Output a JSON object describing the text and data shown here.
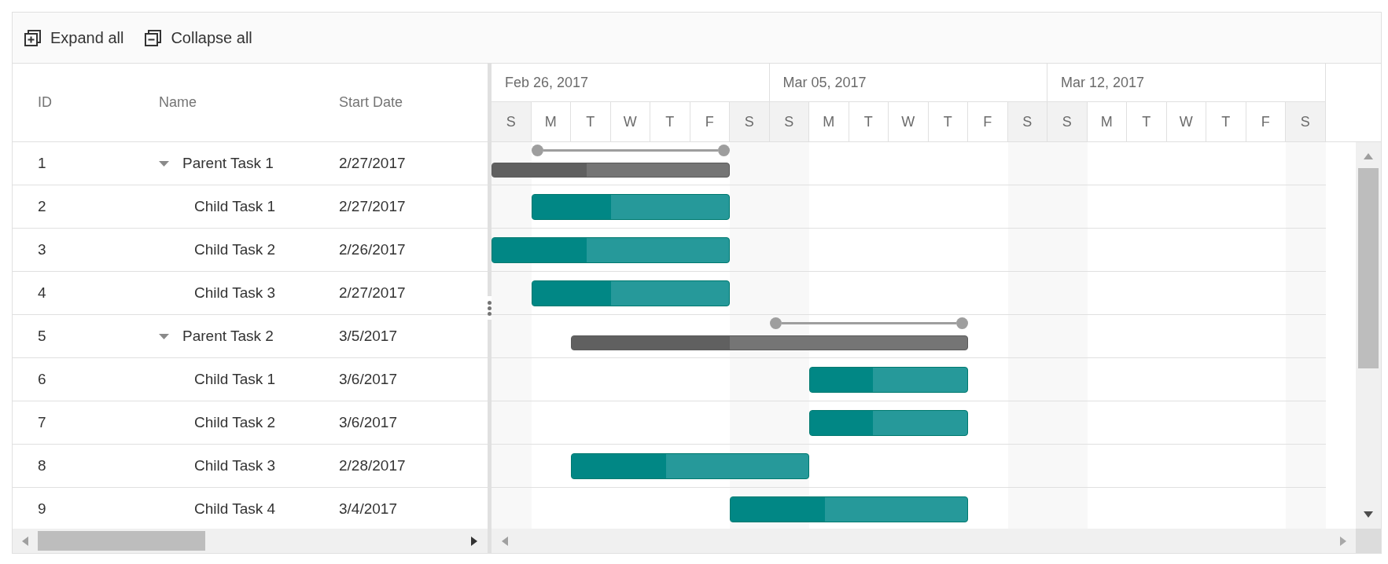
{
  "toolbar": [
    {
      "kind": "expand",
      "label": "Expand all"
    },
    {
      "kind": "collapse",
      "label": "Collapse all"
    }
  ],
  "grid": {
    "columns": [
      "ID",
      "Name",
      "Start Date"
    ]
  },
  "timeline": {
    "weeks": [
      "Feb 26, 2017",
      "Mar 05, 2017",
      "Mar 12, 2017"
    ],
    "days": [
      {
        "label": "S",
        "weekend": true
      },
      {
        "label": "M",
        "weekend": false
      },
      {
        "label": "T",
        "weekend": false
      },
      {
        "label": "W",
        "weekend": false
      },
      {
        "label": "T",
        "weekend": false
      },
      {
        "label": "F",
        "weekend": false
      },
      {
        "label": "S",
        "weekend": true
      },
      {
        "label": "S",
        "weekend": true
      },
      {
        "label": "M",
        "weekend": false
      },
      {
        "label": "T",
        "weekend": false
      },
      {
        "label": "W",
        "weekend": false
      },
      {
        "label": "T",
        "weekend": false
      },
      {
        "label": "F",
        "weekend": false
      },
      {
        "label": "S",
        "weekend": true
      },
      {
        "label": "S",
        "weekend": true
      },
      {
        "label": "M",
        "weekend": false
      },
      {
        "label": "T",
        "weekend": false
      },
      {
        "label": "W",
        "weekend": false
      },
      {
        "label": "T",
        "weekend": false
      },
      {
        "label": "F",
        "weekend": false
      },
      {
        "label": "S",
        "weekend": true
      }
    ]
  },
  "tasks": [
    {
      "id": "1",
      "name": "Parent Task 1",
      "start_date": "2/27/2017",
      "expanded": true,
      "bar": {
        "level": 0.4
      },
      "children": [
        {
          "id": "2",
          "name": "Child Task 1",
          "start_date": "2/27/2017",
          "bar": {
            "level": 0.4
          }
        },
        {
          "id": "3",
          "name": "Child Task 2",
          "start_date": "2/26/2017",
          "bar": {
            "level": 0.4
          }
        },
        {
          "id": "4",
          "name": "Child Task 3",
          "start_date": "2/27/2017",
          "bar": {
            "level": 0.4
          }
        }
      ]
    },
    {
      "id": "5",
      "name": "Parent Task 2",
      "start_date": "3/5/2017",
      "expanded": true,
      "bar": {
        "level": 0.4
      },
      "children": [
        {
          "id": "6",
          "name": "Child Task 1",
          "start_date": "3/6/2017",
          "bar": {
            "level": 0.4
          }
        },
        {
          "id": "7",
          "name": "Child Task 2",
          "start_date": "3/6/2017",
          "bar": {
            "level": 0.4
          }
        },
        {
          "id": "8",
          "name": "Child Task 3",
          "start_date": "2/28/2017",
          "bar": {
            "level": 0.4
          }
        },
        {
          "id": "9",
          "name": "Child Task 4",
          "start_date": "3/4/2017",
          "bar": {
            "level": 0.4
          }
        }
      ]
    }
  ]
}
